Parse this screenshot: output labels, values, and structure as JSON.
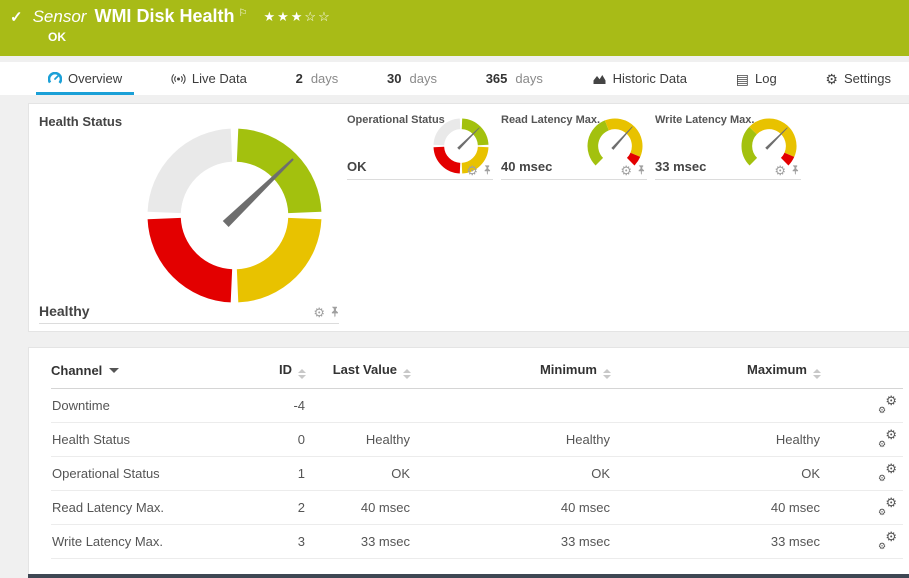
{
  "colors": {
    "header_bg": "#a8bb17",
    "accent_blue": "#1ba0d7",
    "ok": "#a3c10e",
    "warn": "#e8c200",
    "err": "#e30000",
    "idle": "#e9e9e9",
    "needle": "#6e6e6e"
  },
  "header": {
    "check_icon": "✓",
    "kind": "Sensor",
    "title": "WMI Disk Health",
    "flag_icon": "⚐",
    "stars": "★★★☆☆",
    "status": "OK"
  },
  "tabs": [
    {
      "label": "Overview",
      "icon": "gauge",
      "active": true
    },
    {
      "label": "Live Data",
      "icon": "broadcast"
    },
    {
      "num": "2",
      "label": "days"
    },
    {
      "num": "30",
      "label": "days"
    },
    {
      "num": "365",
      "label": "days"
    },
    {
      "label": "Historic Data",
      "icon": "chart"
    },
    {
      "label": "Log",
      "icon": "log",
      "glyph": "▤"
    },
    {
      "label": "Settings",
      "icon": "gear",
      "glyph": "⚙"
    }
  ],
  "icons": {
    "gear": "⚙"
  },
  "gauges": {
    "main": {
      "title": "Health Status",
      "value": "Healthy",
      "type": "quad",
      "needle_deg": 46
    },
    "small": [
      {
        "title": "Operational Status",
        "value": "OK",
        "type": "quad",
        "needle_deg": 45
      },
      {
        "title": "Read Latency Max.",
        "value": "40 msec",
        "type": "arc",
        "needle_deg": 42,
        "segments": [
          {
            "color": "ok",
            "frac": 0.42
          },
          {
            "color": "warn",
            "frac": 0.5
          },
          {
            "color": "err",
            "frac": 0.08
          }
        ]
      },
      {
        "title": "Write Latency Max.",
        "value": "33 msec",
        "type": "arc",
        "needle_deg": 45,
        "segments": [
          {
            "color": "ok",
            "frac": 0.33
          },
          {
            "color": "warn",
            "frac": 0.59
          },
          {
            "color": "err",
            "frac": 0.08
          }
        ]
      }
    ]
  },
  "table": {
    "headers": {
      "channel": "Channel",
      "id": "ID",
      "last": "Last Value",
      "min": "Minimum",
      "max": "Maximum"
    },
    "rows": [
      {
        "channel": "Downtime",
        "id": "-4",
        "last": "",
        "min": "",
        "max": ""
      },
      {
        "channel": "Health Status",
        "id": "0",
        "last": "Healthy",
        "min": "Healthy",
        "max": "Healthy"
      },
      {
        "channel": "Operational Status",
        "id": "1",
        "last": "OK",
        "min": "OK",
        "max": "OK"
      },
      {
        "channel": "Read Latency Max.",
        "id": "2",
        "last": "40 msec",
        "min": "40 msec",
        "max": "40 msec"
      },
      {
        "channel": "Write Latency Max.",
        "id": "3",
        "last": "33 msec",
        "min": "33 msec",
        "max": "33 msec"
      }
    ]
  }
}
